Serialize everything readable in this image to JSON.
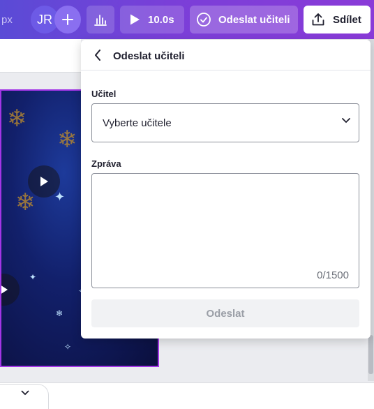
{
  "topbar": {
    "unit_label": "px",
    "avatar_initials": "JR",
    "duration": "10.0s",
    "send_teacher_label": "Odeslat učiteli",
    "share_label": "Sdílet"
  },
  "panel": {
    "title": "Odeslat učiteli",
    "teacher_label": "Učitel",
    "teacher_placeholder": "Vyberte učitele",
    "message_label": "Zpráva",
    "message_value": "",
    "message_counter": "0/1500",
    "submit_label": "Odeslat"
  },
  "colors": {
    "topbar_start": "#5a4bd6",
    "topbar_end": "#8a3bd8",
    "selection_border": "#a235e6"
  }
}
